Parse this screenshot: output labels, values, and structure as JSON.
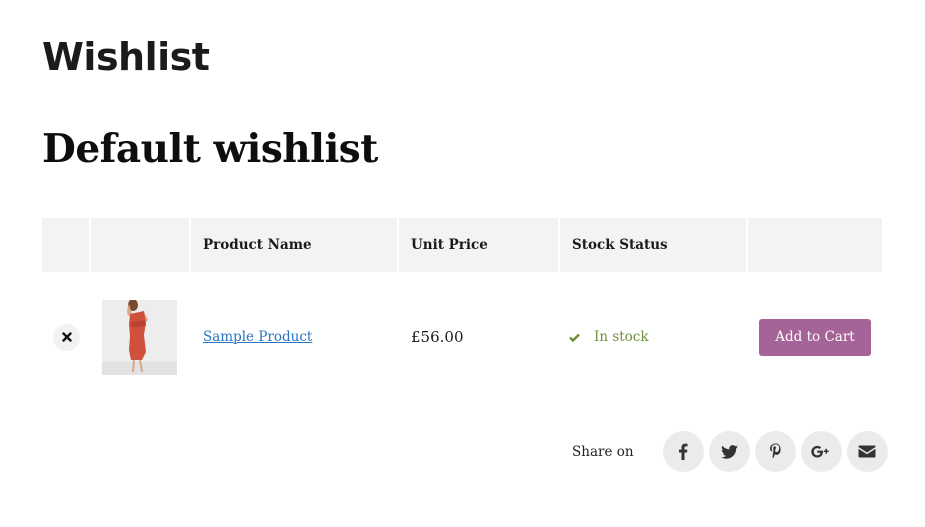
{
  "page": {
    "title": "Wishlist"
  },
  "wishlist": {
    "title": "Default wishlist"
  },
  "table": {
    "columns": [
      "",
      "",
      "Product Name",
      "Unit Price",
      "Stock Status",
      ""
    ],
    "rows": [
      {
        "remove_icon": "close-icon",
        "product_image": "red-dress-thumbnail",
        "product_name": "Sample Product",
        "unit_price": "£56.00",
        "stock_icon": "check-icon",
        "stock_status": "In stock",
        "action_label": "Add to Cart"
      }
    ]
  },
  "share": {
    "label": "Share on",
    "networks": [
      {
        "name": "facebook",
        "icon": "facebook-icon"
      },
      {
        "name": "twitter",
        "icon": "twitter-icon"
      },
      {
        "name": "pinterest",
        "icon": "pinterest-icon"
      },
      {
        "name": "google-plus",
        "icon": "google-plus-icon"
      },
      {
        "name": "email",
        "icon": "envelope-icon"
      }
    ]
  },
  "colors": {
    "accent_button": "#a46497",
    "link": "#2a73c2",
    "in_stock": "#6f8f39",
    "header_bg": "#f3f3f3",
    "share_bg": "#ebebeb"
  }
}
